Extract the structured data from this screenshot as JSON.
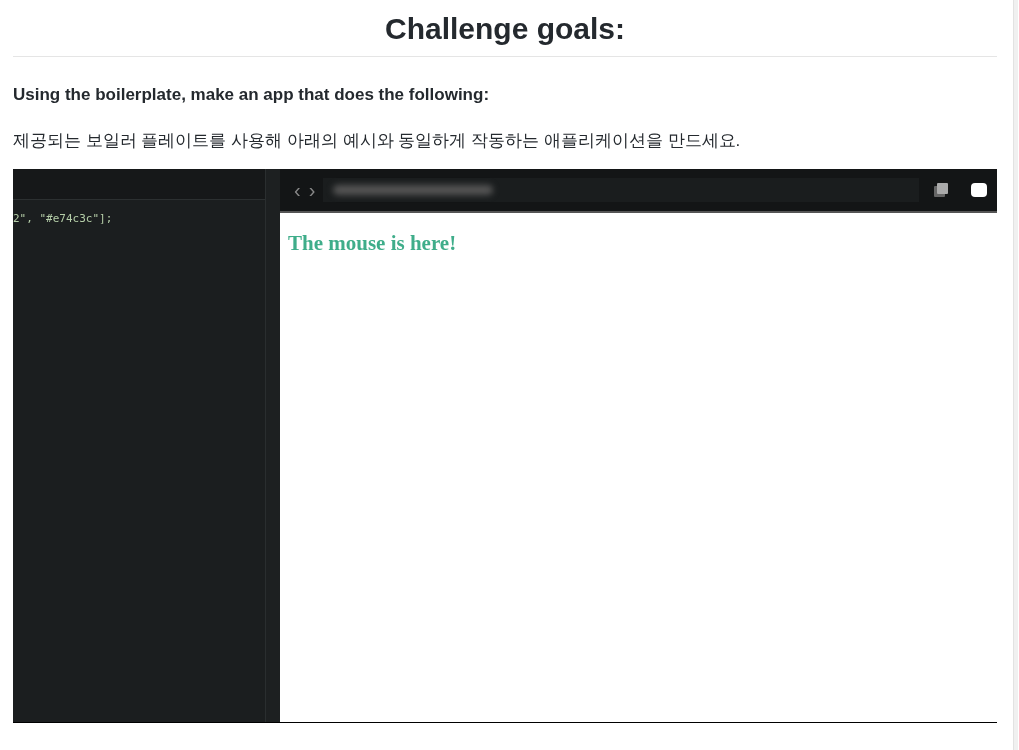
{
  "heading": "Challenge goals:",
  "paragraphs": [
    "Using the boilerplate, make an app that does the following:",
    "제공되는 보일러 플레이트를 사용해 아래의 예시와 동일하게 작동하는 애플리케이션을 만드세요."
  ],
  "demo": {
    "code_line": "2\", \"#e74c3c\"];",
    "browser": {
      "back": "‹",
      "forward": "›",
      "output_text": "The mouse is here!"
    }
  }
}
